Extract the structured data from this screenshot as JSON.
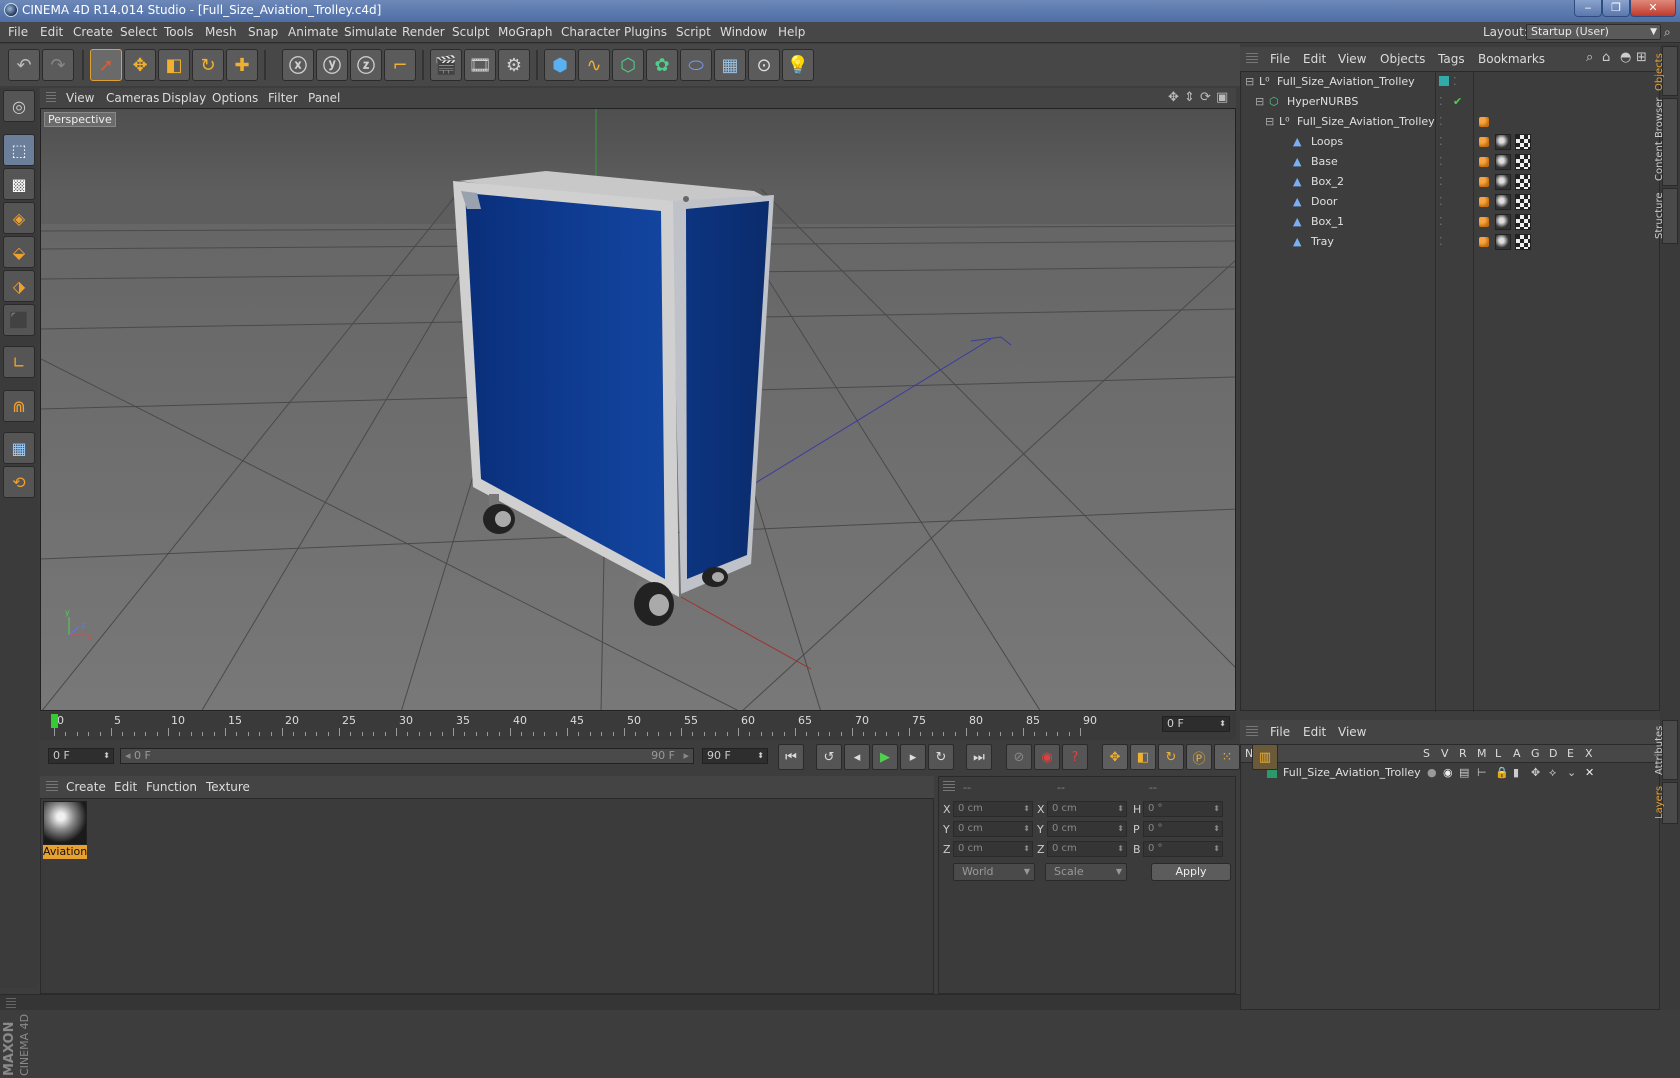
{
  "window": {
    "title": "CINEMA 4D R14.014 Studio - [Full_Size_Aviation_Trolley.c4d]",
    "min_glyph": "‒",
    "max_glyph": "❐",
    "close_glyph": "✕"
  },
  "menubar": {
    "items": [
      "File",
      "Edit",
      "Create",
      "Select",
      "Tools",
      "Mesh",
      "Snap",
      "Animate",
      "Simulate",
      "Render",
      "Sculpt",
      "MoGraph",
      "Character",
      "Plugins",
      "Script",
      "Window",
      "Help"
    ],
    "layout_label": "Layout:",
    "layout_value": "Startup (User)"
  },
  "viewport": {
    "menu": [
      "View",
      "Cameras",
      "Display",
      "Options",
      "Filter",
      "Panel"
    ],
    "camera_label": "Perspective"
  },
  "object_manager": {
    "menu": [
      "File",
      "Edit",
      "View",
      "Objects",
      "Tags",
      "Bookmarks"
    ],
    "rows": [
      {
        "name": "Full_Size_Aviation_Trolley",
        "type": "null",
        "level": 0
      },
      {
        "name": "HyperNURBS",
        "type": "hypernurbs",
        "level": 1
      },
      {
        "name": "Full_Size_Aviation_Trolley",
        "type": "null",
        "level": 2
      },
      {
        "name": "Loops",
        "type": "polygon",
        "level": 3
      },
      {
        "name": "Base",
        "type": "polygon",
        "level": 3
      },
      {
        "name": "Box_2",
        "type": "polygon",
        "level": 3
      },
      {
        "name": "Door",
        "type": "polygon",
        "level": 3
      },
      {
        "name": "Box_1",
        "type": "polygon",
        "level": 3
      },
      {
        "name": "Tray",
        "type": "polygon",
        "level": 3
      }
    ]
  },
  "layer_manager": {
    "menu": [
      "File",
      "Edit",
      "View"
    ],
    "columns": [
      "Name",
      "S",
      "V",
      "R",
      "M",
      "L",
      "A",
      "G",
      "D",
      "E",
      "X"
    ],
    "rows": [
      {
        "name": "Full_Size_Aviation_Trolley"
      }
    ]
  },
  "side_tabs": [
    "Objects",
    "Content Browser",
    "Structure",
    "Attributes",
    "Layers"
  ],
  "timeline": {
    "ticks": [
      0,
      5,
      10,
      15,
      20,
      25,
      30,
      35,
      40,
      45,
      50,
      55,
      60,
      65,
      70,
      75,
      80,
      85,
      90
    ],
    "current_frame": "0 F"
  },
  "transport": {
    "start_field": "0 F",
    "range_start": "0 F",
    "range_end": "90 F",
    "end_field": "90 F"
  },
  "material_manager": {
    "menu": [
      "Create",
      "Edit",
      "Function",
      "Texture"
    ],
    "materials": [
      {
        "name": "Aviation"
      }
    ]
  },
  "coordinates": {
    "header": [
      "--",
      "--",
      "--"
    ],
    "rows": [
      {
        "l1": "X",
        "v1": "0 cm",
        "l2": "X",
        "v2": "0 cm",
        "l3": "H",
        "v3": "0 °"
      },
      {
        "l1": "Y",
        "v1": "0 cm",
        "l2": "Y",
        "v2": "0 cm",
        "l3": "P",
        "v3": "0 °"
      },
      {
        "l1": "Z",
        "v1": "0 cm",
        "l2": "Z",
        "v2": "0 cm",
        "l3": "B",
        "v3": "0 °"
      }
    ],
    "mode": "World",
    "transform": "Scale",
    "apply_label": "Apply"
  },
  "branding": {
    "maxon": "MAXON",
    "c4d": "CINEMA 4D"
  },
  "colors": {
    "accent": "#e8a030",
    "viewport_bg": "#6e6e6e",
    "trolley_blue": "#0e3a8c"
  }
}
